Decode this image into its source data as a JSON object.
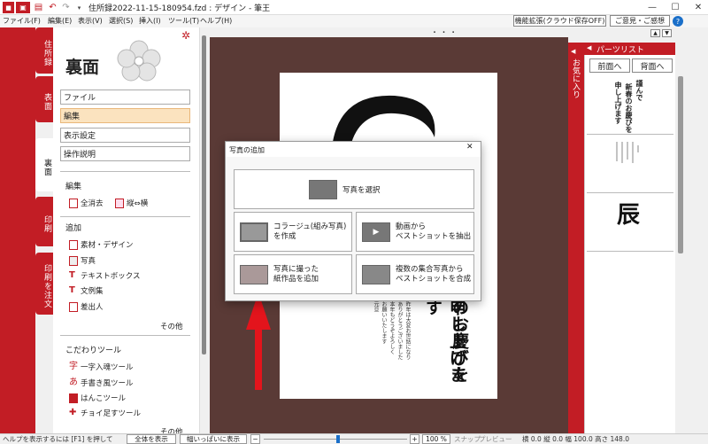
{
  "window": {
    "title": "住所録2022-11-15-180954.fzd : デザイン - 筆王",
    "controls": {
      "minimize": "—",
      "maximize": "☐",
      "close": "✕"
    }
  },
  "menubar": {
    "items": [
      "ファイル(F)",
      "編集(E)",
      "表示(V)",
      "選択(S)",
      "挿入(I)",
      "ツール(T)",
      "ヘルプ(H)"
    ],
    "feature_button": "機能拡張(クラウド保存OFF)",
    "feedback_button": "ご意見・ご感想"
  },
  "left_tabs": [
    "住所録",
    "表面",
    "裏面",
    "印刷",
    "印刷を注文"
  ],
  "panel": {
    "title": "裏面",
    "buttons": [
      "ファイル",
      "編集",
      "表示設定",
      "操作説明"
    ],
    "edit_section": {
      "heading": "編集",
      "clear_all": "全消去",
      "vertical_horizontal": "縦⇔横"
    },
    "add_section": {
      "heading": "追加",
      "items": [
        "素材・デザイン",
        "写真",
        "テキストボックス",
        "文例集",
        "差出人"
      ],
      "more": "その他"
    },
    "tools_section": {
      "heading": "こだわりツール",
      "items": [
        "一字入魂ツール",
        "手書き風ツール",
        "はんこツール",
        "チョイ足すツール"
      ],
      "more": "その他"
    }
  },
  "canvas": {
    "ruler_dots": "・ ・ ・",
    "card_text_large": [
      "のお慶びを",
      "申し上げます"
    ],
    "card_text_small": [
      "昨年は大変お世話になり",
      "ありがとうございました",
      "本年もどうぞよろしく",
      "お願いいたします"
    ],
    "card_text_sender": "元旦"
  },
  "right_panel": {
    "header": "パーツリスト",
    "favorites_tab": "お気に入り",
    "front_button": "前面へ",
    "back_button": "背面へ",
    "part1_text": [
      "謹んで",
      "新春のお慶びを",
      "申し上げます"
    ],
    "part3_char": "辰"
  },
  "dialog": {
    "title": "写真の追加",
    "select_photo": "写真を選択",
    "collage": [
      "コラージュ(組み写真)",
      "を作成"
    ],
    "video": [
      "動画から",
      "ベストショットを抽出"
    ],
    "paper_work": [
      "写真に撮った",
      "紙作品を追加"
    ],
    "group_photo": [
      "複数の集合写真から",
      "ベストショットを合成"
    ],
    "close": "✕"
  },
  "statusbar": {
    "help": "ヘルプを表示するには [F1] を押して",
    "fit_all": "全体を表示",
    "fit_width": "幅いっぱいに表示",
    "zoom_minus": "−",
    "zoom_plus": "+",
    "zoom_value": "100 %",
    "zoom_level": 0.52,
    "snap": "スナップ",
    "preview": "プレビュー",
    "coords": "横 0.0 縦 0.0 幅 100.0 高さ 148.0"
  },
  "colors": {
    "accent": "#c21d25",
    "selected": "#fbe3bf",
    "canvas_bg": "#5a3a36"
  }
}
